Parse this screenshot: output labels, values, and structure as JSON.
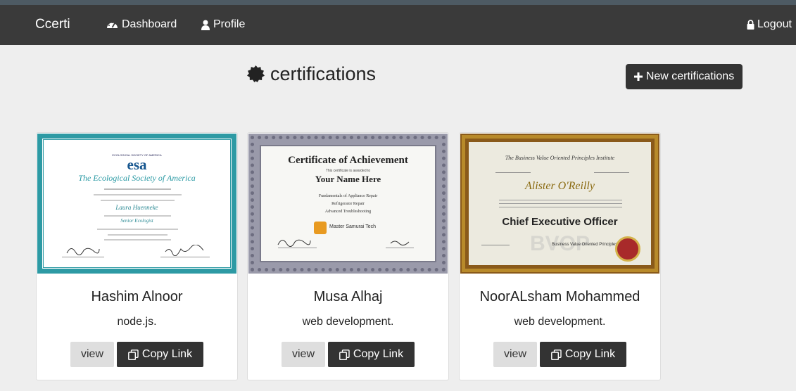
{
  "navbar": {
    "brand": "Ccerti",
    "items": [
      {
        "label": "Dashboard",
        "icon": "dashboard-icon"
      },
      {
        "label": "Profile",
        "icon": "user-icon"
      }
    ],
    "logout_label": "Logout",
    "logout_icon": "lock-icon"
  },
  "page": {
    "title": "certifications",
    "title_icon": "badge-icon",
    "new_button_label": "New certifications"
  },
  "cards": [
    {
      "name": "Hashim Alnoor",
      "subject": "node.js.",
      "view_label": "view",
      "copy_label": "Copy Link",
      "certificate": {
        "org_small": "ECOLOGICAL SOCIETY OF AMERICA",
        "logo": "esa",
        "heading": "The Ecological Society of America",
        "recipient": "Laura Huenneke",
        "role": "Senior Ecologist"
      }
    },
    {
      "name": "Musa Alhaj",
      "subject": "web development.",
      "view_label": "view",
      "copy_label": "Copy Link",
      "certificate": {
        "heading": "Certificate of Achievement",
        "awarded": "This certificate is awarded to",
        "recipient": "Your Name Here",
        "line1": "Fundamentals of Appliance Repair",
        "line2": "Refrigerator Repair",
        "line3": "Advanced Troubleshooting",
        "org": "Master Samurai Tech"
      }
    },
    {
      "name": "NoorALsham Mohammed",
      "subject": "web development.",
      "view_label": "view",
      "copy_label": "Copy Link",
      "certificate": {
        "heading": "The Business Value Oriented Principles Institute",
        "recipient": "Alister O'Reilly",
        "role": "Chief Executive Officer",
        "watermark": "BVOP",
        "footer": "Business Value Oriented Principles Institute"
      }
    }
  ],
  "colors": {
    "navbar": "#3a3a3a",
    "background": "#eeeeee",
    "dark_button": "#333333",
    "light_button": "#dedede"
  }
}
